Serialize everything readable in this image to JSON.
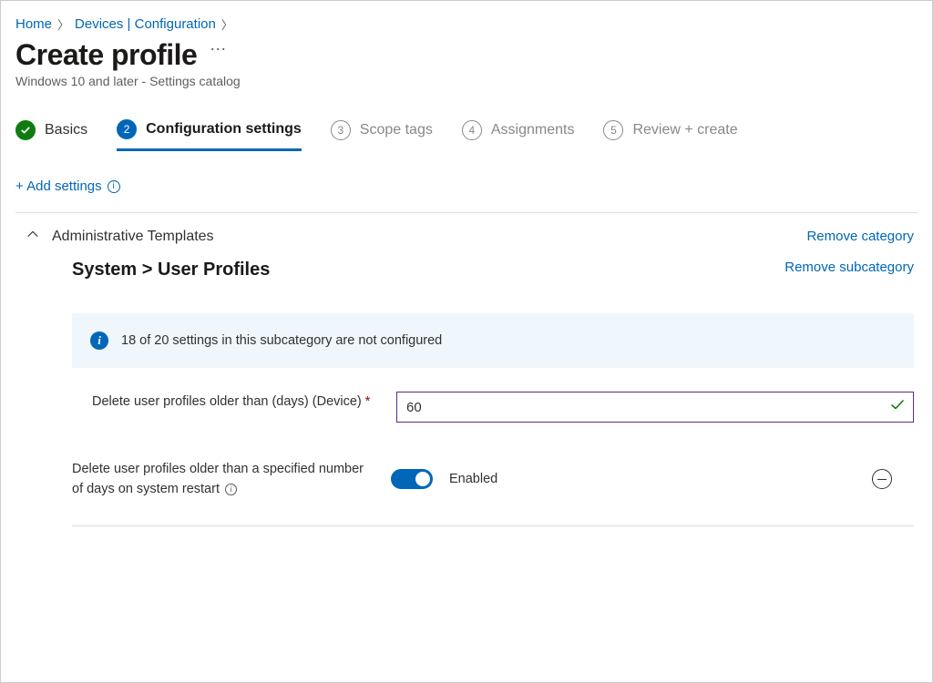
{
  "breadcrumb": {
    "home": "Home",
    "devices": "Devices | Configuration"
  },
  "title": "Create profile",
  "subtitle": "Windows 10 and later - Settings catalog",
  "steps": {
    "basics": "Basics",
    "config": "Configuration settings",
    "scope": "Scope tags",
    "assign": "Assignments",
    "review": "Review + create",
    "n3": "3",
    "n4": "4",
    "n5": "5",
    "n2": "2"
  },
  "add_settings": "+ Add settings",
  "category": {
    "name": "Administrative Templates",
    "remove": "Remove category"
  },
  "subcategory": {
    "name": "System > User Profiles",
    "remove": "Remove subcategory"
  },
  "banner": "18 of 20 settings in this subcategory are not configured",
  "setting1": {
    "label": "Delete user profiles older than (days) (Device)",
    "required": "*",
    "value": "60"
  },
  "setting2": {
    "label": "Delete user profiles older than a specified number of days on system restart",
    "status": "Enabled"
  }
}
